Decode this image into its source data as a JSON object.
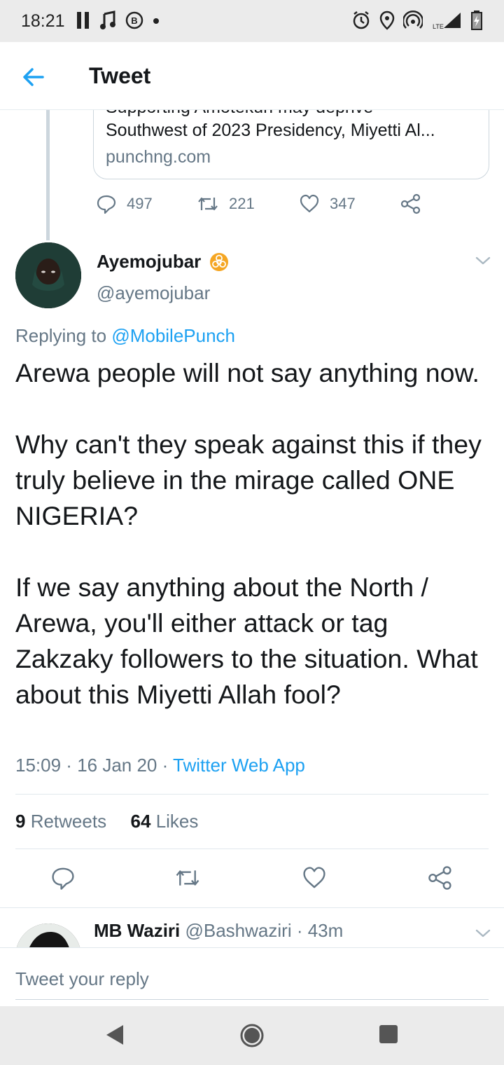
{
  "status_bar": {
    "time": "18:21",
    "left_icons": [
      "pause-icon",
      "music-icon",
      "b-icon",
      "dot-icon"
    ],
    "right_icons": [
      "alarm-icon",
      "location-icon",
      "hotspot-icon",
      "lte-signal-icon",
      "battery-icon"
    ],
    "lte_label": "LTE"
  },
  "header": {
    "title": "Tweet",
    "accent": "#1da1f2"
  },
  "quoted_card": {
    "cut_line": "Supporting Amotekun may deprive",
    "title": "Southwest of 2023 Presidency, Miyetti Al...",
    "domain": "punchng.com"
  },
  "parent_actions": {
    "replies": "497",
    "retweets": "221",
    "likes": "347"
  },
  "tweet": {
    "author_name": "Ayemojubar",
    "badge_icon": "biohazard-icon",
    "badge_color": "#f5a623",
    "handle": "@ayemojubar",
    "replying_prefix": "Replying to ",
    "replying_mention": "@MobilePunch",
    "paragraphs": [
      "Arewa people will not say anything now.",
      "Why can't they speak against this if they truly believe in the mirage called ONE NIGERIA?",
      "If we say anything about the North / Arewa, you'll either attack or tag Zakzaky followers to the situation. What about this Miyetti Allah fool?"
    ],
    "time": "15:09",
    "sep1": " · ",
    "date": "16 Jan 20",
    "sep2": " · ",
    "source": "Twitter Web App",
    "retweet_count": "9",
    "retweet_label": " Retweets",
    "like_count": "64",
    "like_label": " Likes"
  },
  "next_reply": {
    "name": "MB Waziri",
    "handle": " @Bashwaziri",
    "sep": " · ",
    "time": "43m"
  },
  "reply_bar": {
    "placeholder": "Tweet your reply"
  }
}
